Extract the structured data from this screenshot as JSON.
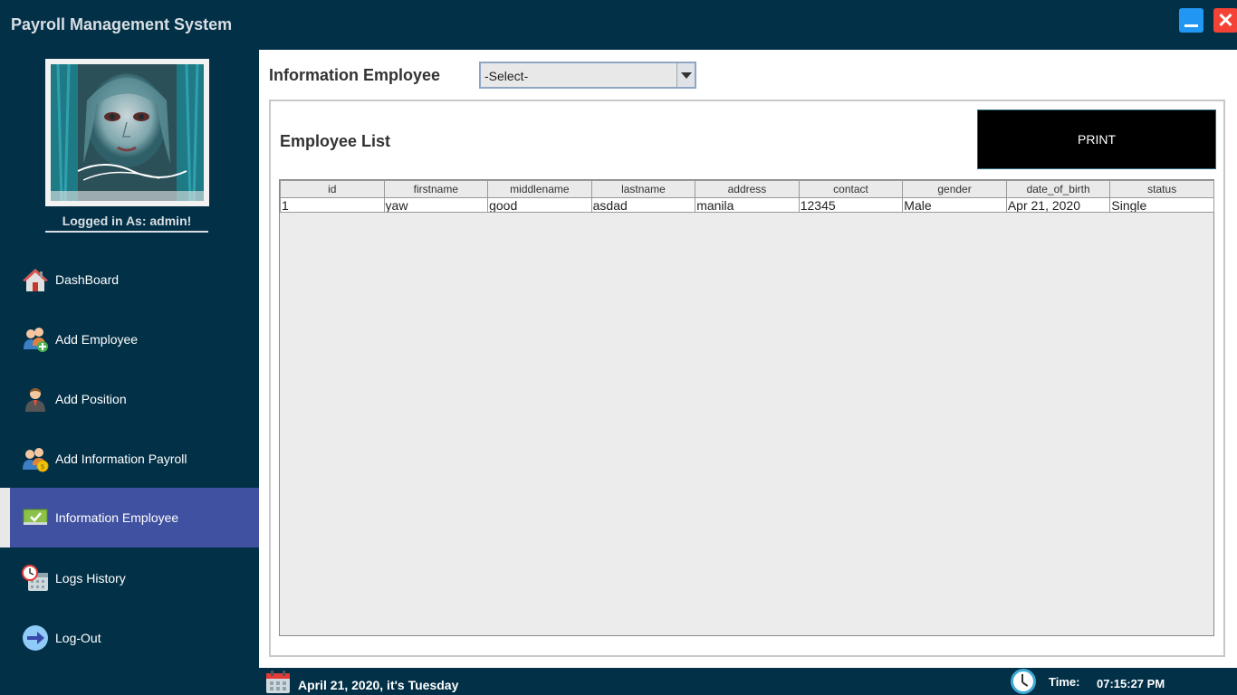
{
  "app": {
    "title": "Payroll Management System"
  },
  "window_controls": {
    "minimize_icon": "minimize-icon",
    "close_icon": "close-icon",
    "close_glyph": "✕",
    "colors": {
      "minimize": "#2196f3",
      "close": "#f44336"
    }
  },
  "sidebar": {
    "logged_in_text": "Logged in As: admin!",
    "avatar_icon": "profile-artwork-image",
    "items": [
      {
        "label": "DashBoard",
        "icon": "house-icon"
      },
      {
        "label": "Add Employee",
        "icon": "add-employee-icon"
      },
      {
        "label": "Add Position",
        "icon": "person-icon"
      },
      {
        "label": "Add Information Payroll",
        "icon": "people-coin-icon"
      },
      {
        "label": "Information Employee",
        "icon": "id-card-icon",
        "active": true
      },
      {
        "label": "Logs History",
        "icon": "calendar-clock-icon"
      },
      {
        "label": "Log-Out",
        "icon": "arrow-right-icon"
      }
    ],
    "colors": {
      "background": "#023047",
      "active": "#3f51a0"
    }
  },
  "main": {
    "title": "Information Employee",
    "select": {
      "value": "-Select-"
    },
    "panel": {
      "title": "Employee List",
      "print_label": "PRINT",
      "table": {
        "columns": [
          "id",
          "firstname",
          "middlename",
          "lastname",
          "address",
          "contact",
          "gender",
          "date_of_birth",
          "status"
        ],
        "rows": [
          [
            "1",
            "yaw",
            "good",
            "asdad",
            "manila",
            "12345",
            "Male",
            "Apr 21, 2020",
            "Single"
          ]
        ]
      }
    }
  },
  "statusbar": {
    "date": "April 21, 2020, it's Tuesday",
    "time_label": "Time:",
    "time_value": "07:15:27 PM"
  }
}
